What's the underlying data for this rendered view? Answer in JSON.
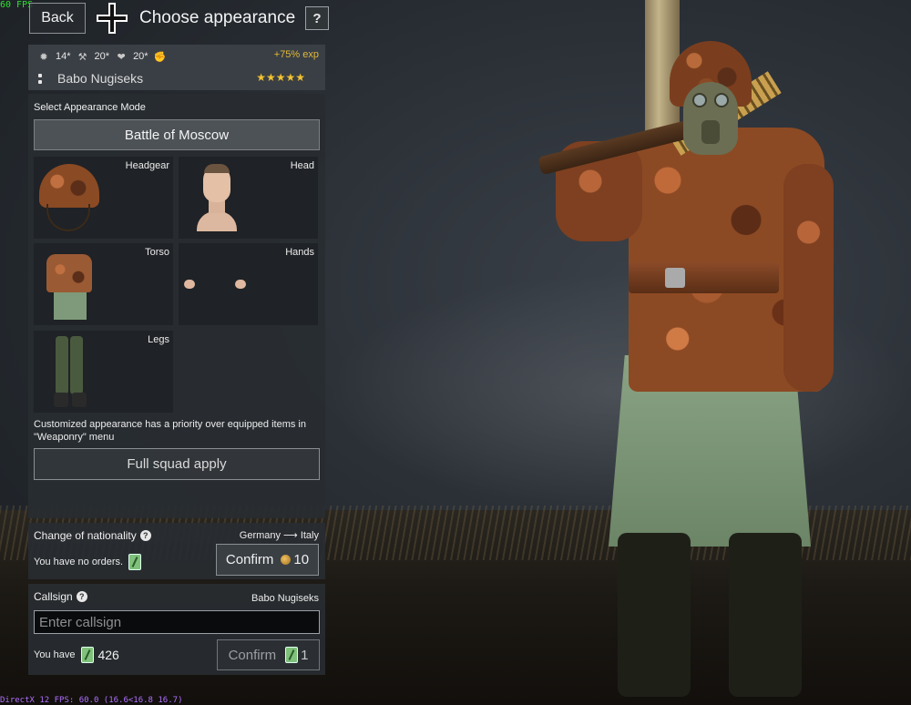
{
  "hud": {
    "fps_top": "60 FPS",
    "fps_bottom": "DirectX 12 FPS: 60.0 (16.6<16.8 16.7)"
  },
  "header": {
    "back_label": "Back",
    "title": "Choose appearance",
    "help_label": "?",
    "nation_icon": "balkenkreuz-icon"
  },
  "soldier": {
    "stat1": "14*",
    "stat2": "20*",
    "stat3": "20*",
    "exp_bonus": "+75% exp",
    "name": "Babo Nugiseks",
    "stars": "★★★★★"
  },
  "appearance": {
    "mode_label": "Select Appearance Mode",
    "mode_value": "Battle of Moscow",
    "slots": {
      "headgear": "Headgear",
      "head": "Head",
      "torso": "Torso",
      "hands": "Hands",
      "legs": "Legs"
    },
    "priority_note": "Customized appearance has a priority over equipped items in \"Weaponry\" menu",
    "squad_apply_label": "Full squad apply"
  },
  "nationality": {
    "title": "Change of nationality",
    "from": "Germany",
    "arrow": "⟶",
    "to": "Italy",
    "orders_text": "You have no orders.",
    "confirm_label": "Confirm",
    "cost": "10"
  },
  "callsign": {
    "title": "Callsign",
    "current": "Babo Nugiseks",
    "placeholder": "Enter callsign",
    "value": "",
    "have_label": "You have",
    "have_count": "426",
    "confirm_label": "Confirm",
    "cost": "1"
  },
  "colors": {
    "accent_gold": "#e0b83a",
    "star_gold": "#f2c230",
    "fps_green": "#2fe02f",
    "order_green": "#7fc07a"
  }
}
